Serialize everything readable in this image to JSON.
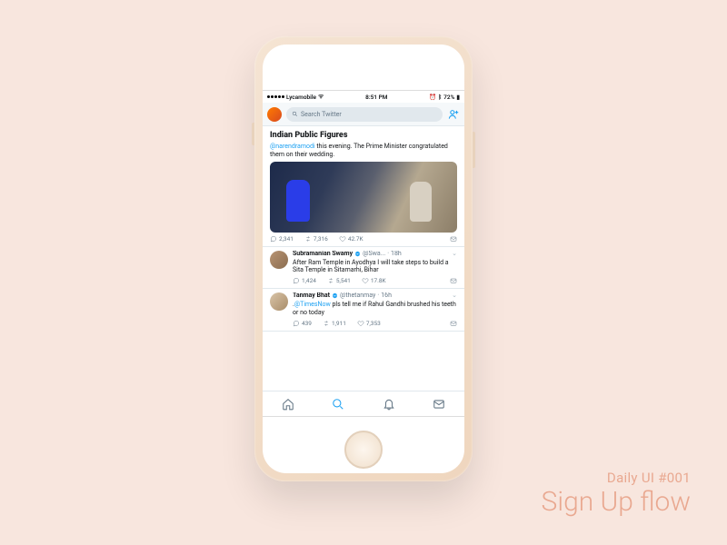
{
  "canvas": {
    "label_small": "Daily UI #001",
    "label_big": "Sign Up flow"
  },
  "status": {
    "carrier": "Lycamobile",
    "time": "8:51 PM",
    "battery": "72%"
  },
  "search": {
    "placeholder": "Search Twitter"
  },
  "section": {
    "title": "Indian Public Figures"
  },
  "tweets": [
    {
      "text_pre": "",
      "mention": "@narendramodi",
      "text_post": " this evening. The Prime Minister congratulated them on their wedding.",
      "replies": "2,341",
      "retweets": "7,316",
      "likes": "42.7K"
    },
    {
      "name": "Subramanian Swamy",
      "handle": "@Swa...",
      "time": "18h",
      "text_pre": "After Ram Temple in Ayodhya I will take steps to build a Sita Temple in Sitamarhi, Bihar",
      "mention": "",
      "text_post": "",
      "replies": "1,424",
      "retweets": "5,541",
      "likes": "17.8K"
    },
    {
      "name": "Tanmay Bhat",
      "handle": "@thetanmay",
      "time": "16h",
      "text_pre": ".",
      "mention": "@TimesNow",
      "text_post": " pls tell me if Rahul Gandhi brushed his teeth or no today",
      "replies": "439",
      "retweets": "1,911",
      "likes": "7,353"
    }
  ]
}
